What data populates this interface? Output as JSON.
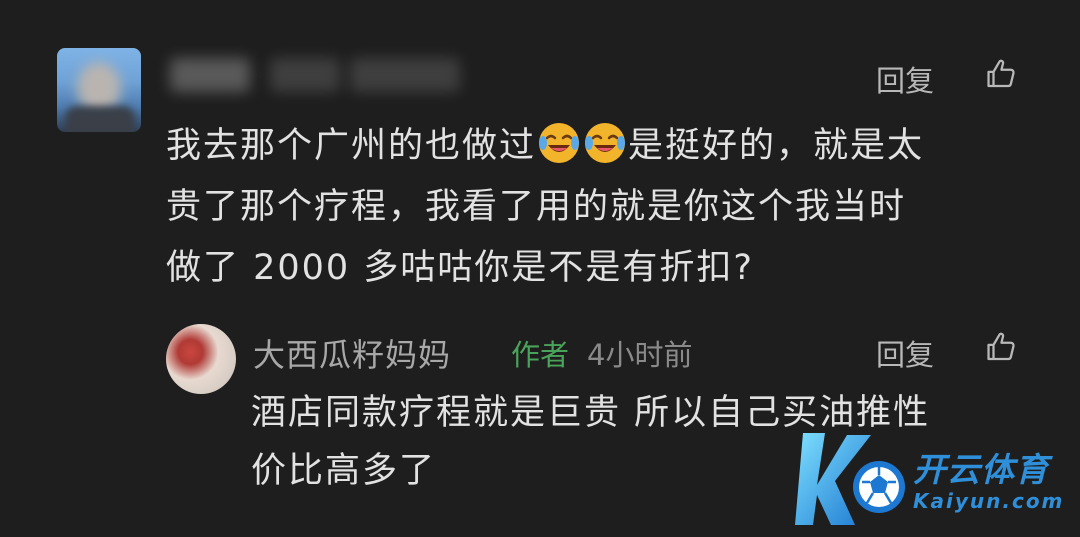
{
  "comment": {
    "username": "",
    "reply_label": "回复",
    "text_lines": [
      {
        "before": "我去那个广州的也做过",
        "after": "是挺好的，就是太"
      },
      {
        "before": "贵了那个疗程，我看了用的就是你这个我当时",
        "after": ""
      },
      {
        "before": "做了 2000 多咕咕你是不是有折扣?",
        "after": ""
      }
    ],
    "emoji_count": 2,
    "emoji_name": "laugh-cry-emoji"
  },
  "reply": {
    "author_name": "大西瓜籽妈妈",
    "author_badge": "作者",
    "time_ago": "4小时前",
    "reply_label": "回复",
    "text_lines": [
      "酒店同款疗程就是巨贵 所以自己买油推性",
      "价比高多了"
    ]
  },
  "watermark": {
    "brand": "开云体育",
    "domain": "Kaiyun.com"
  },
  "colors": {
    "background": "#1e1e1e",
    "text_primary": "#e2e2e2",
    "text_secondary": "#a8a8a8",
    "author_badge": "#4aa35a",
    "watermark_blue": "#2f8fd8"
  },
  "icons": {
    "like": "thumbs-up-icon"
  }
}
